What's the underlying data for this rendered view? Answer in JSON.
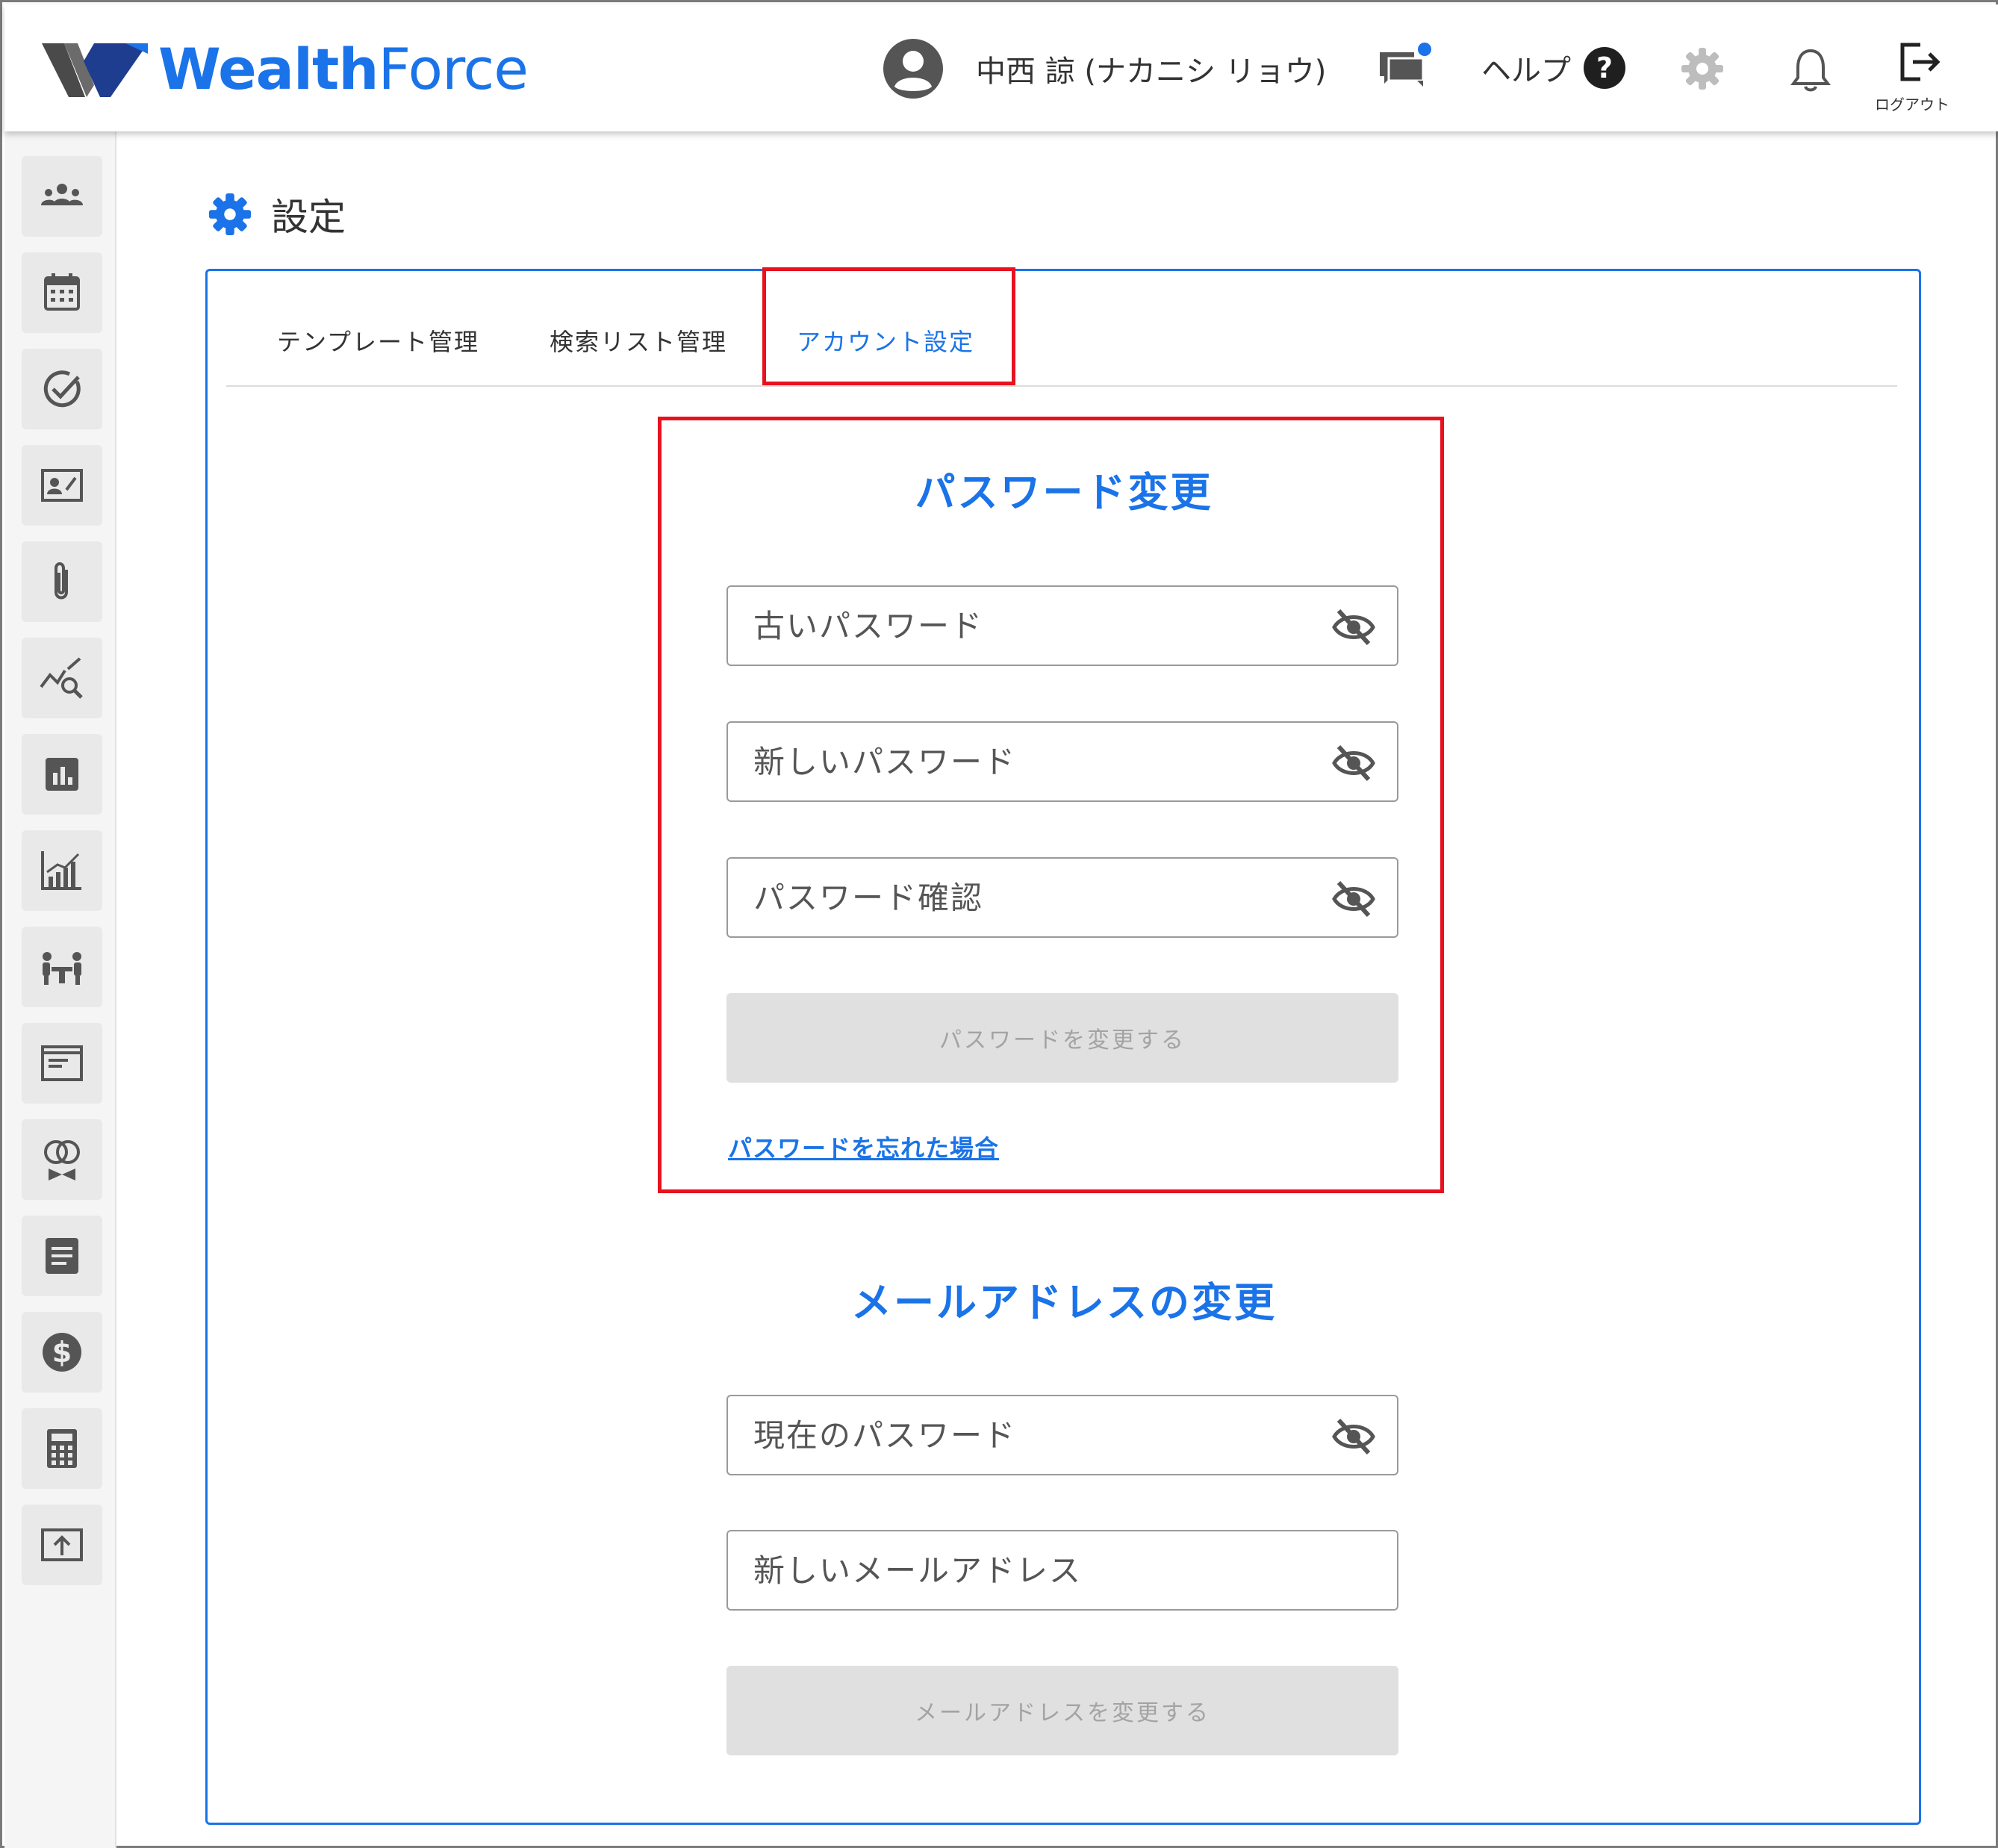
{
  "brand": {
    "name_a": "Wealth",
    "name_b": "Force",
    "accent": "#1a73e8"
  },
  "header": {
    "user_name": "中西 諒 (ナカニシ リョウ)",
    "help_label": "ヘルプ",
    "logout_label": "ログアウト",
    "icons": [
      "user-avatar-icon",
      "chat-icon",
      "help-icon",
      "gear-icon",
      "bell-icon",
      "logout-icon"
    ]
  },
  "sidebar": {
    "items": [
      {
        "icon": "people-icon"
      },
      {
        "icon": "calendar-icon"
      },
      {
        "icon": "check-circle-icon"
      },
      {
        "icon": "contact-card-icon"
      },
      {
        "icon": "paperclip-icon"
      },
      {
        "icon": "chart-search-icon"
      },
      {
        "icon": "bar-chart-box-icon"
      },
      {
        "icon": "growth-chart-icon"
      },
      {
        "icon": "meeting-icon"
      },
      {
        "icon": "document-box-icon"
      },
      {
        "icon": "rings-icon"
      },
      {
        "icon": "note-icon"
      },
      {
        "icon": "dollar-icon"
      },
      {
        "icon": "calculator-icon"
      },
      {
        "icon": "upload-icon"
      }
    ]
  },
  "page": {
    "title": "設定"
  },
  "tabs": [
    {
      "label": "テンプレート管理",
      "active": false
    },
    {
      "label": "検索リスト管理",
      "active": false
    },
    {
      "label": "アカウント設定",
      "active": true
    }
  ],
  "password_section": {
    "title": "パスワード変更",
    "old_password_placeholder": "古いパスワード",
    "new_password_placeholder": "新しいパスワード",
    "confirm_password_placeholder": "パスワード確認",
    "submit_label": "パスワードを変更する",
    "forgot_link": "パスワードを忘れた場合"
  },
  "email_section": {
    "title": "メールアドレスの変更",
    "current_password_placeholder": "現在のパスワード",
    "new_email_placeholder": "新しいメールアドレス",
    "submit_label": "メールアドレスを変更する"
  },
  "colors": {
    "highlight": "#e8121f",
    "disabled_bg": "#e0e0e0"
  }
}
